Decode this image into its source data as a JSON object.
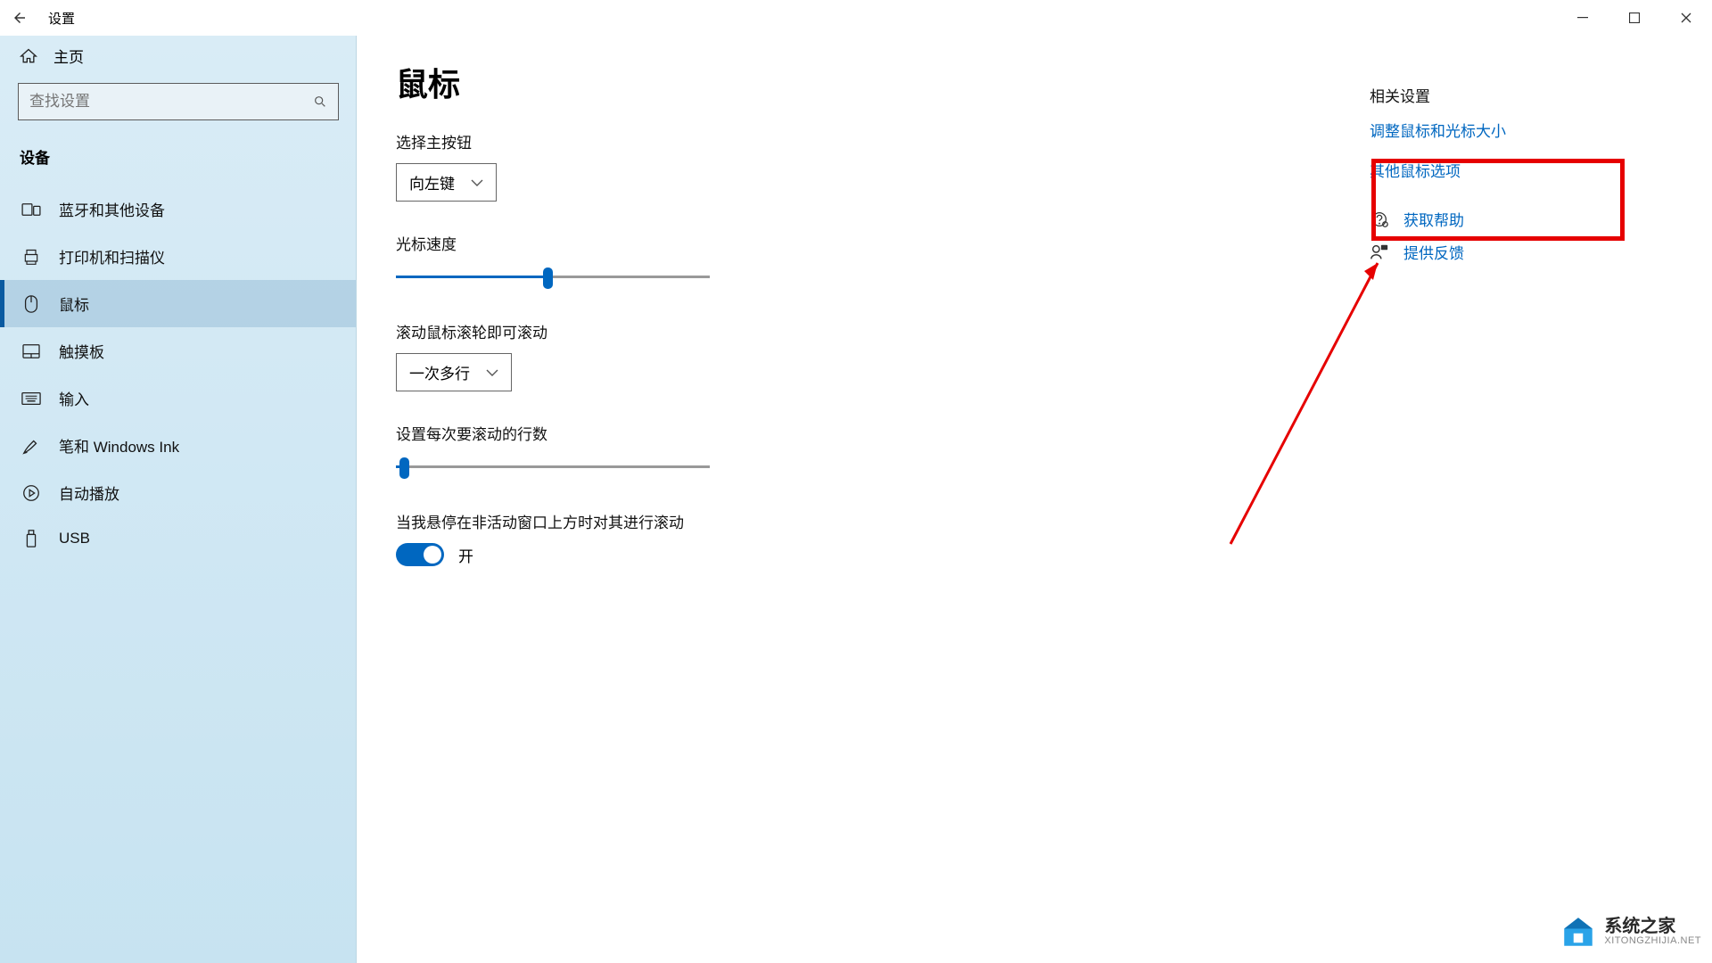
{
  "window": {
    "title": "设置"
  },
  "sidebar": {
    "home_label": "主页",
    "search_placeholder": "查找设置",
    "section_title": "设备",
    "items": [
      {
        "label": "蓝牙和其他设备"
      },
      {
        "label": "打印机和扫描仪"
      },
      {
        "label": "鼠标"
      },
      {
        "label": "触摸板"
      },
      {
        "label": "输入"
      },
      {
        "label": "笔和 Windows Ink"
      },
      {
        "label": "自动播放"
      },
      {
        "label": "USB"
      }
    ]
  },
  "main": {
    "title": "鼠标",
    "primary_button": {
      "label": "选择主按钮",
      "value": "向左键"
    },
    "cursor_speed": {
      "label": "光标速度",
      "value": 50
    },
    "scroll_mode": {
      "label": "滚动鼠标滚轮即可滚动",
      "value": "一次多行"
    },
    "scroll_lines": {
      "label": "设置每次要滚动的行数",
      "value": 2
    },
    "hover_scroll": {
      "label": "当我悬停在非活动窗口上方时对其进行滚动",
      "state_label": "开"
    }
  },
  "right": {
    "title": "相关设置",
    "link_adjust": "调整鼠标和光标大小",
    "link_other": "其他鼠标选项",
    "help_label": "获取帮助",
    "feedback_label": "提供反馈"
  },
  "watermark": {
    "line1": "系统之家",
    "line2": "XITONGZHIJIA.NET"
  }
}
